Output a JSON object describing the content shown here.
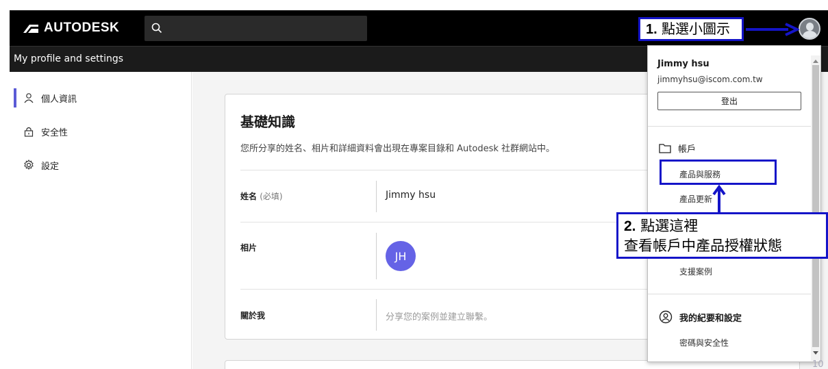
{
  "header": {
    "logo_text": "AUTODESK",
    "subtitle": "My profile and settings"
  },
  "sidebar": {
    "items": [
      {
        "label": "個人資訊",
        "icon": "user-icon",
        "active": true
      },
      {
        "label": "安全性",
        "icon": "lock-icon",
        "active": false
      },
      {
        "label": "設定",
        "icon": "gear-icon",
        "active": false
      }
    ]
  },
  "card": {
    "title": "基礎知識",
    "description": "您所分享的姓名、相片和詳細資料會出現在專案目錄和 Autodesk 社群網站中。",
    "rows": [
      {
        "label": "姓名",
        "label_note": "(必填)",
        "value": "Jimmy hsu"
      },
      {
        "label": "相片",
        "avatar_initials": "JH"
      },
      {
        "label": "關於我",
        "placeholder": "分享您的案例並建立聯繫。"
      }
    ]
  },
  "dropdown": {
    "user_name": "Jimmy hsu",
    "email": "jimmyhsu@iscom.com.tw",
    "logout_label": "登出",
    "account_section": "帳戶",
    "account_links": [
      "產品與服務",
      "產品更新",
      "支援案例"
    ],
    "profile_section": "我的紀要和設定",
    "profile_links": [
      "密碼與安全性"
    ]
  },
  "annotations": {
    "step1_num": "1.",
    "step1_text": "點選小圖示",
    "step2_num": "2.",
    "step2_line1": "點選這裡",
    "step2_line2": "查看帳戶中產品授權狀態"
  },
  "page_number": "10",
  "colors": {
    "accent": "#5b5bd6",
    "avatar_bg": "#6563e6",
    "annotation_blue": "#1414c8",
    "header_bg": "#000000"
  }
}
